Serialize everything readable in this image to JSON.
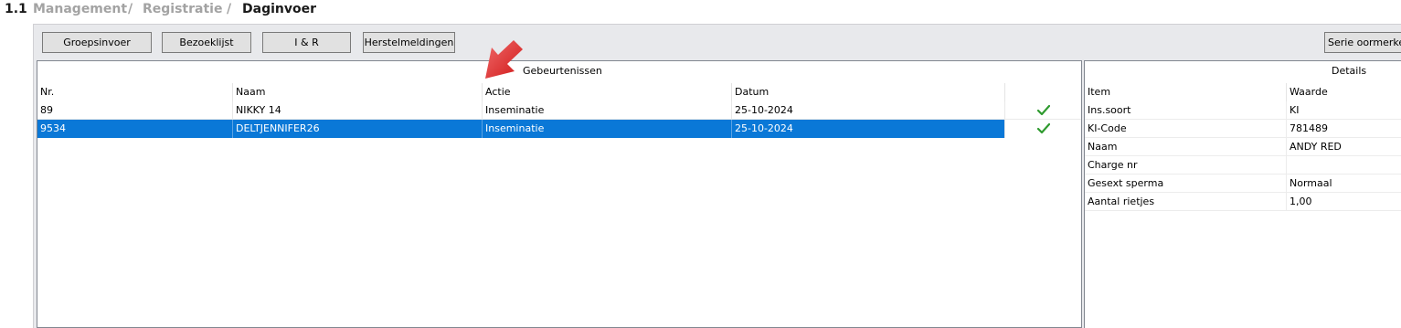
{
  "breadcrumb": {
    "number": "1.1",
    "items": [
      "Management",
      "/",
      "Registratie",
      "/",
      "Daginvoer"
    ]
  },
  "toolbar": {
    "groepsinvoer": "Groepsinvoer",
    "bezoeklijst": "Bezoeklijst",
    "ir": "I & R",
    "herstelmeldingen": "Herstelmeldingen",
    "serie": "Serie oormerken"
  },
  "events": {
    "title": "Gebeurtenissen",
    "columns": [
      "Nr.",
      "Naam",
      "Actie",
      "Datum"
    ],
    "rows": [
      {
        "nr": "89",
        "naam": "NIKKY 14",
        "actie": "Inseminatie",
        "datum": "25-10-2024",
        "status": "check-icon"
      },
      {
        "nr": "9534",
        "naam": "DELTJENNIFER26",
        "actie": "Inseminatie",
        "datum": "25-10-2024",
        "status": "check-icon"
      }
    ]
  },
  "details": {
    "title": "Details",
    "columns": [
      "Item",
      "Waarde"
    ],
    "rows": [
      {
        "item": "Ins.soort",
        "waarde": "KI"
      },
      {
        "item": "KI-Code",
        "waarde": "781489"
      },
      {
        "item": "Naam",
        "waarde": "ANDY RED"
      },
      {
        "item": "Charge nr",
        "waarde": ""
      },
      {
        "item": "Gesext sperma",
        "waarde": "Normaal"
      },
      {
        "item": "Aantal rietjes",
        "waarde": "1,00"
      }
    ]
  },
  "colors": {
    "selection": "#0a78d7",
    "check": "#2e9a2e",
    "arrow": "#e53935"
  }
}
